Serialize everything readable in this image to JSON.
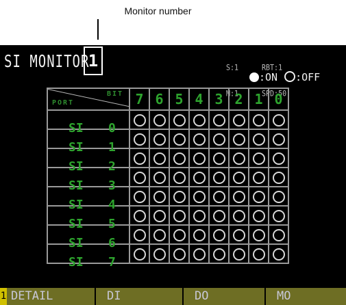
{
  "annotation": {
    "label": "Monitor number"
  },
  "screen": {
    "title": "SI MONITOR",
    "monitor_number": "1",
    "status": {
      "line1_a": "S:1",
      "line2_a": "M:1",
      "line1_b": "RBT:1",
      "line2_b": "SPD:50"
    },
    "legend": {
      "on_label": ":ON",
      "off_label": ":OFF"
    }
  },
  "table": {
    "header_port": "PORT",
    "header_bit": "BIT",
    "bits": [
      "7",
      "6",
      "5",
      "4",
      "3",
      "2",
      "1",
      "0"
    ],
    "rows": [
      {
        "label": "SI",
        "num": "0"
      },
      {
        "label": "SI",
        "num": "1"
      },
      {
        "label": "SI",
        "num": "2"
      },
      {
        "label": "SI",
        "num": "3"
      },
      {
        "label": "SI",
        "num": "4"
      },
      {
        "label": "SI",
        "num": "5"
      },
      {
        "label": "SI",
        "num": "6"
      },
      {
        "label": "SI",
        "num": "7"
      }
    ]
  },
  "function_keys": [
    {
      "num": "1",
      "label": "DETAIL"
    },
    {
      "label": "DI"
    },
    {
      "label": "DO"
    },
    {
      "label": "MO"
    }
  ]
}
